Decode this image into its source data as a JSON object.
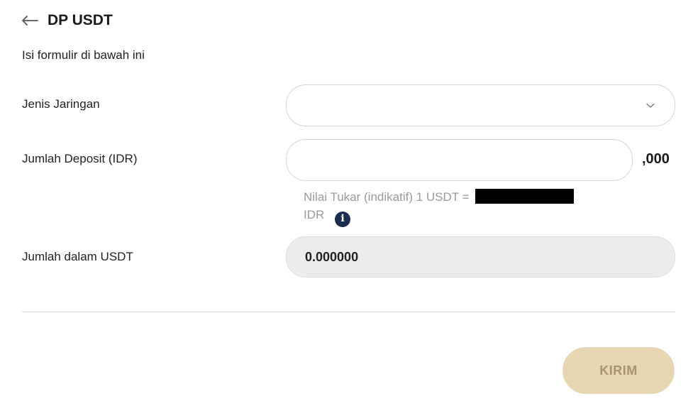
{
  "header": {
    "title": "DP USDT"
  },
  "form": {
    "subtitle": "Isi formulir di bawah ini",
    "network": {
      "label": "Jenis Jaringan",
      "value": ""
    },
    "deposit": {
      "label": "Jumlah Deposit (IDR)",
      "value": "",
      "suffix": ",000"
    },
    "rate": {
      "text": "Nilai Tukar (indikatif) 1 USDT =",
      "unit": "IDR"
    },
    "usdt": {
      "label": "Jumlah dalam USDT",
      "value": "0.000000"
    },
    "submit_label": "KIRIM"
  },
  "icons": {
    "back": "arrow-left-icon",
    "select": "chevron-down-icon",
    "info": "info-icon"
  },
  "colors": {
    "info": "#1a2e52",
    "submit_bg": "#e6d6b3",
    "submit_text": "#a9956d",
    "readonly_bg": "#ececec"
  }
}
